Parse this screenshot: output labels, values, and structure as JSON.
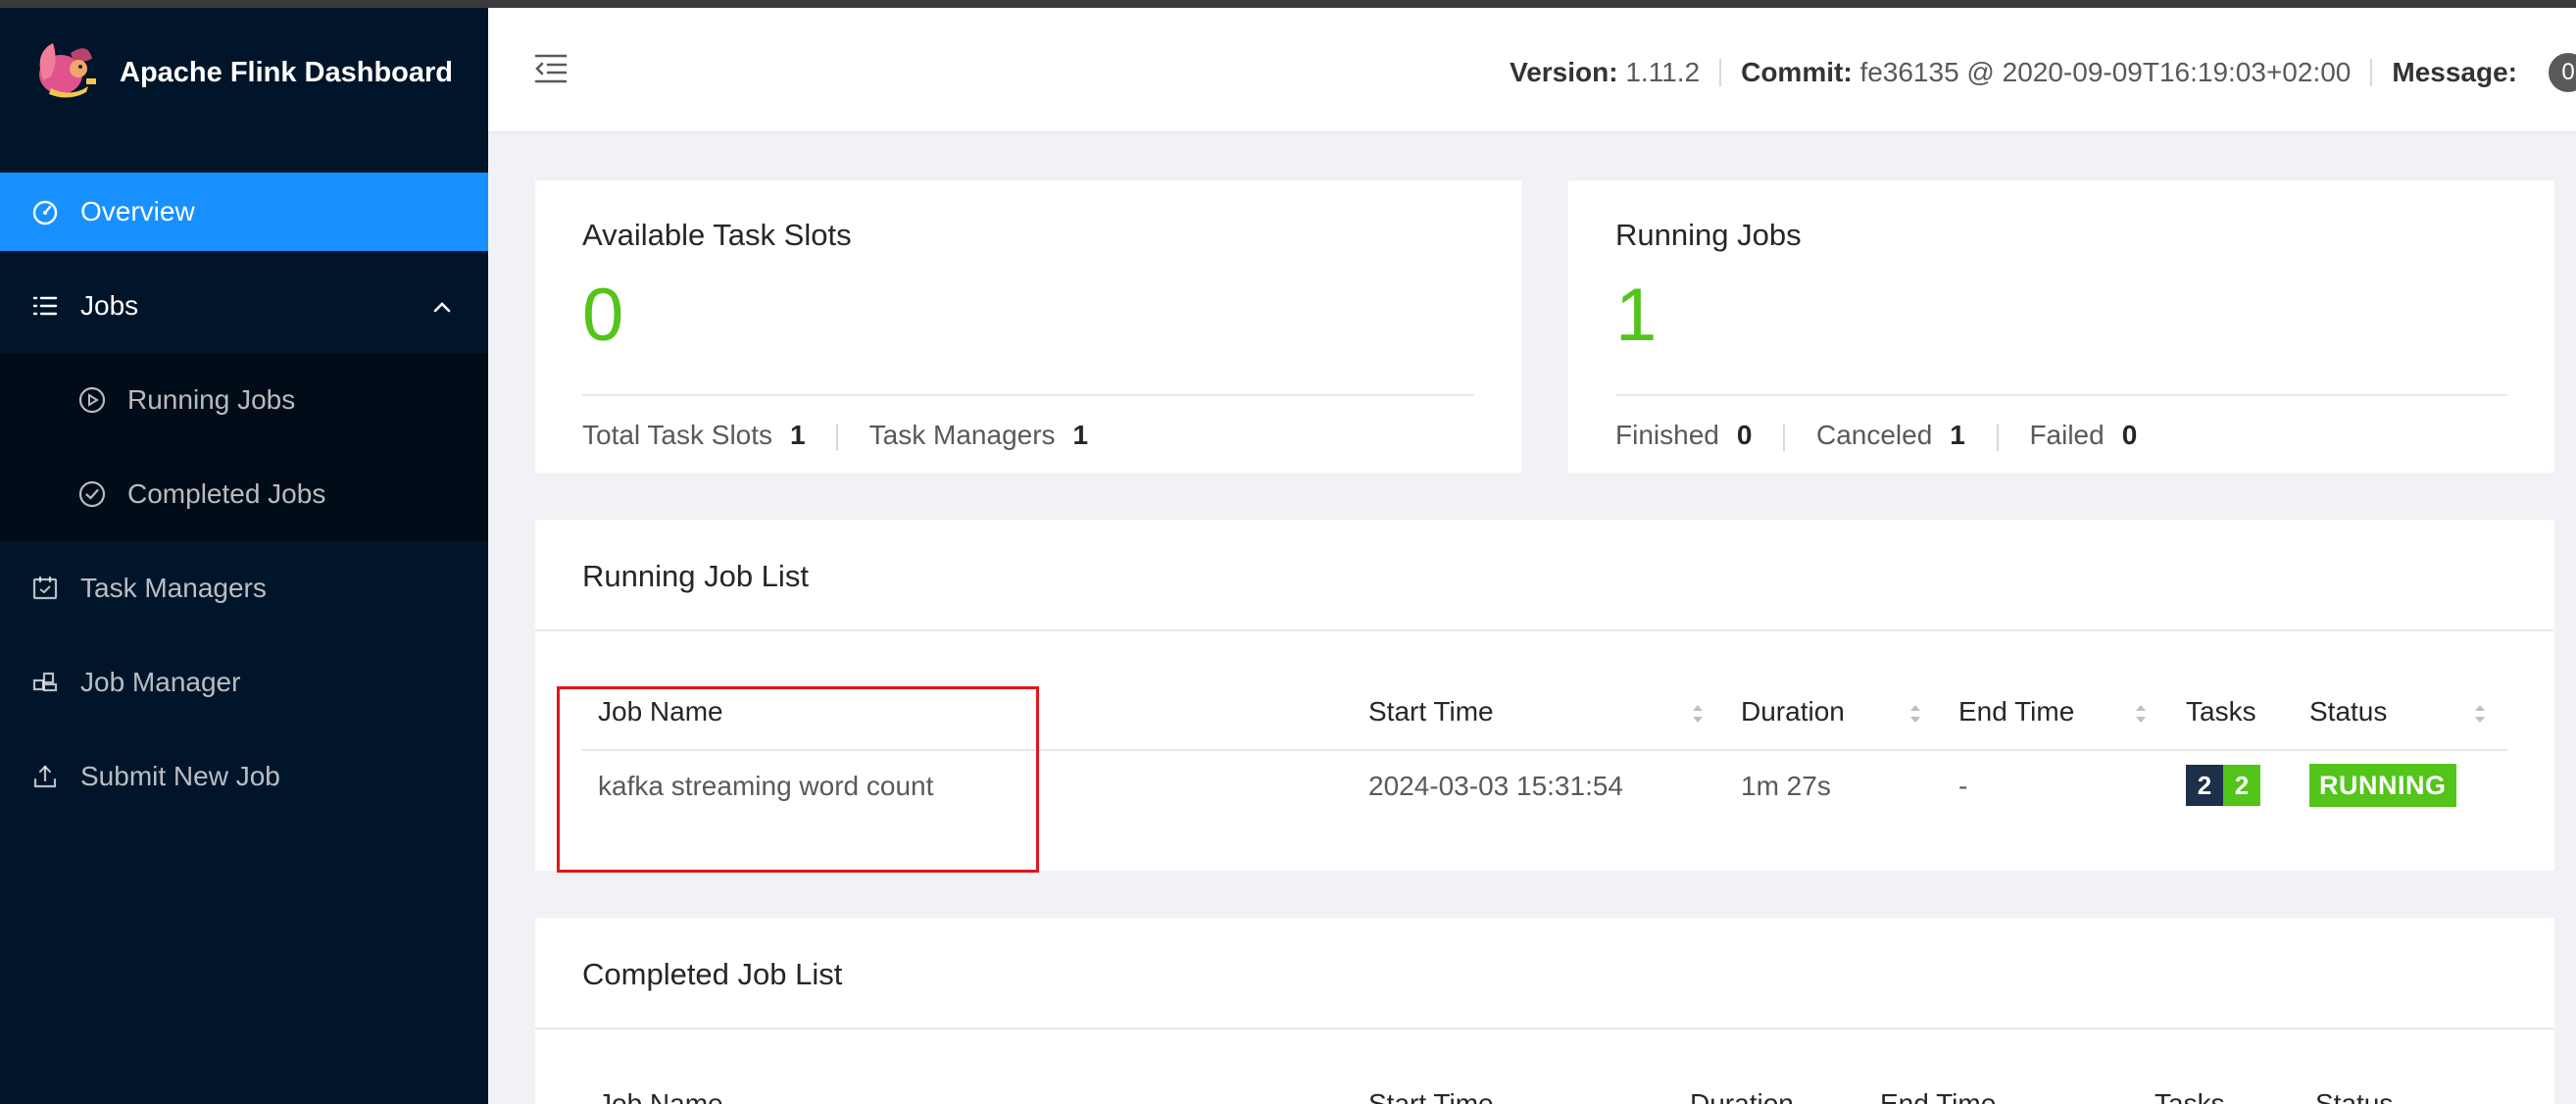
{
  "app": {
    "title": "Apache Flink Dashboard"
  },
  "sidebar": {
    "items": [
      {
        "label": "Overview",
        "icon": "dashboard-icon"
      },
      {
        "label": "Jobs",
        "icon": "list-icon"
      },
      {
        "label": "Running Jobs",
        "icon": "play-circle-icon"
      },
      {
        "label": "Completed Jobs",
        "icon": "check-circle-icon"
      },
      {
        "label": "Task Managers",
        "icon": "schedule-icon"
      },
      {
        "label": "Job Manager",
        "icon": "cluster-icon"
      },
      {
        "label": "Submit New Job",
        "icon": "upload-icon"
      }
    ]
  },
  "header": {
    "version_label": "Version:",
    "version_value": "1.11.2",
    "commit_label": "Commit:",
    "commit_value": "fe36135 @ 2020-09-09T16:19:03+02:00",
    "message_label": "Message:",
    "message_count": "0"
  },
  "slots_card": {
    "title": "Available Task Slots",
    "value": "0",
    "total_label": "Total Task Slots",
    "total_value": "1",
    "tm_label": "Task Managers",
    "tm_value": "1"
  },
  "jobs_card": {
    "title": "Running Jobs",
    "value": "1",
    "finished_label": "Finished",
    "finished_value": "0",
    "canceled_label": "Canceled",
    "canceled_value": "1",
    "failed_label": "Failed",
    "failed_value": "0"
  },
  "running_list": {
    "title": "Running Job List",
    "columns": [
      "Job Name",
      "Start Time",
      "Duration",
      "End Time",
      "Tasks",
      "Status"
    ],
    "rows": [
      {
        "name": "kafka streaming word count",
        "start_time": "2024-03-03 15:31:54",
        "duration": "1m 27s",
        "end_time": "-",
        "tasks_total": "2",
        "tasks_running": "2",
        "status": "RUNNING"
      }
    ]
  },
  "completed_list": {
    "title": "Completed Job List",
    "columns": [
      "Job Name",
      "Start Time",
      "Duration",
      "End Time",
      "Tasks",
      "Status"
    ]
  },
  "colors": {
    "sidebar_bg": "#001529",
    "active": "#1890ff",
    "running_green": "#52c41a",
    "task_dark": "#1e2f4a",
    "highlight_red": "#e0151c"
  }
}
